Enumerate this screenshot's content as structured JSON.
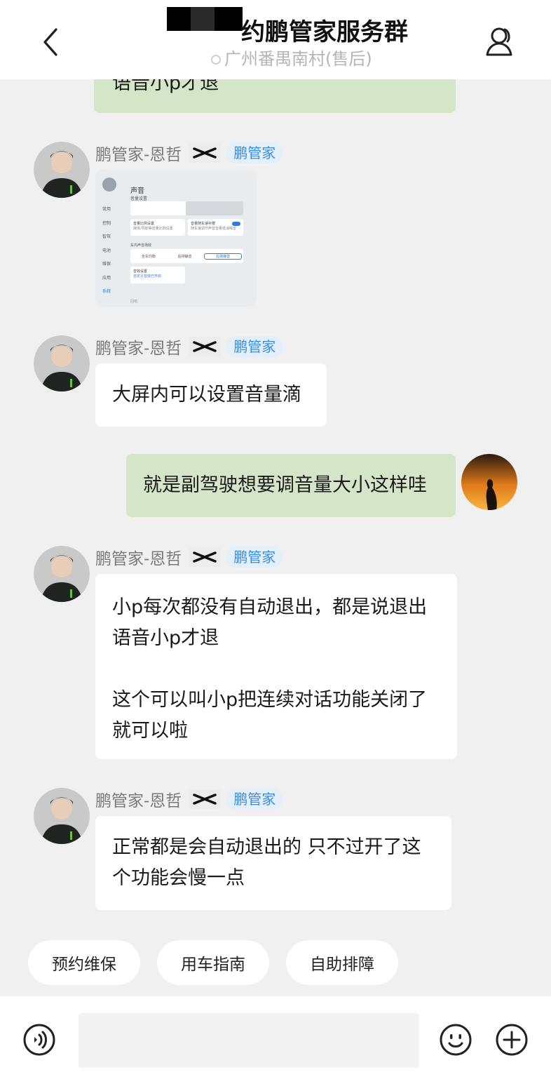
{
  "header": {
    "title": "约鹏管家服务群",
    "subtitle": "广州番禺南村(售后)"
  },
  "messages": [
    {
      "side": "right",
      "text": "语音小p才退"
    },
    {
      "side": "left",
      "sender": "鹏管家-恩哲",
      "tag": "鹏管家",
      "type": "image",
      "image_texts": {
        "title": "声音",
        "volume_settings": "音量设置",
        "nav": [
          "常用",
          "控制",
          "智驾",
          "电池",
          "维保",
          "应用",
          "系统"
        ],
        "card1_title": "音量比例设置",
        "card1_sub": "媒体/导航等音量比例设置",
        "card2_title": "音量随车速补偿",
        "card2_sub": "随车速调节声音音量抵消噪音",
        "section": "车内声音场效",
        "seg": [
          "全车均衡",
          "后排静音",
          "后排静音"
        ],
        "card3_title": "音效设置",
        "card3_sub": "自定义音效已开启",
        "bottom": "回响"
      }
    },
    {
      "side": "left",
      "sender": "鹏管家-恩哲",
      "tag": "鹏管家",
      "text": "大屏内可以设置音量滴"
    },
    {
      "side": "right",
      "text": "就是副驾驶想要调音量大小这样哇"
    },
    {
      "side": "left",
      "sender": "鹏管家-恩哲",
      "tag": "鹏管家",
      "text": "小p每次都没有自动退出，都是说退出\n语音小p才退\n\n这个可以叫小p把连续对话功能关闭了\n就可以啦"
    },
    {
      "side": "left",
      "sender": "鹏管家-恩哲",
      "tag": "鹏管家",
      "text": "正常都是会自动退出的 只不过开了这\n个功能会慢一点"
    }
  ],
  "quick_actions": [
    "预约维保",
    "用车指南",
    "自助排障"
  ],
  "footer": {
    "input_value": ""
  },
  "colors": {
    "green_bubble": "#d5e5c7",
    "tag_blue": "#3b8de3",
    "background": "#f0f0f0"
  },
  "icons": [
    "back-icon",
    "person-icon",
    "voice-icon",
    "emoji-icon",
    "plus-icon",
    "xpeng-logo-icon"
  ]
}
